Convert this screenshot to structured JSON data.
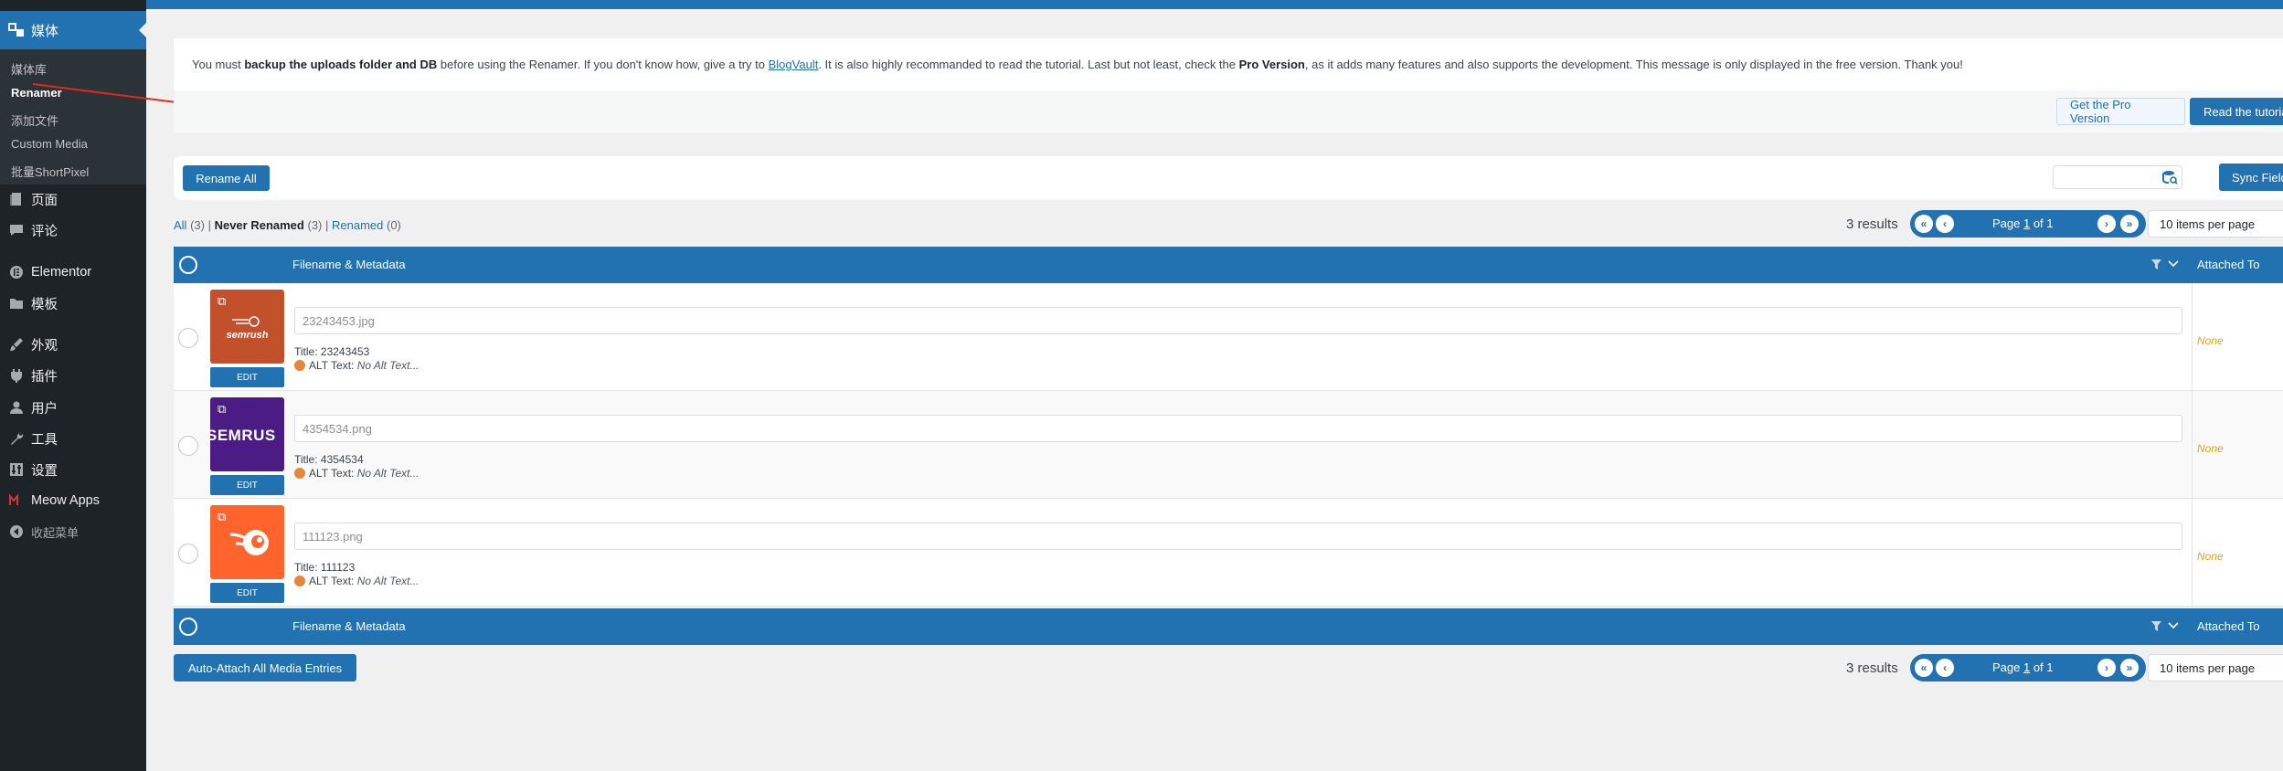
{
  "sidebar": {
    "current": "媒体",
    "submenu": [
      "媒体库",
      "Renamer",
      "添加文件",
      "Custom Media",
      "批量ShortPixel"
    ],
    "items": [
      {
        "icon": "pages-icon",
        "label": "页面"
      },
      {
        "icon": "comments-icon",
        "label": "评论"
      },
      {
        "icon": "elementor-icon",
        "label": "Elementor"
      },
      {
        "icon": "templates-icon",
        "label": "模板"
      },
      {
        "icon": "appearance-icon",
        "label": "外观"
      },
      {
        "icon": "plugins-icon",
        "label": "插件"
      },
      {
        "icon": "users-icon",
        "label": "用户"
      },
      {
        "icon": "tools-icon",
        "label": "工具"
      },
      {
        "icon": "settings-icon",
        "label": "设置"
      },
      {
        "icon": "meow-icon",
        "label": "Meow Apps"
      },
      {
        "icon": "collapse-icon",
        "label": "收起菜单"
      }
    ]
  },
  "notice": {
    "t1": "You must ",
    "b1": "backup the uploads folder and DB",
    "t2": " before using the Renamer. If you don't know how, give a try to ",
    "link": "BlogVault",
    "t3": ". It is also highly recommanded to read the tutorial. Last but not least, check the ",
    "b2": "Pro Version",
    "t4": ", as it adds many features and also supports the development. This message is only displayed in the free version. Thank you!",
    "pro_button": "Get the Pro Version",
    "tutorial_button": "Read the tutorial"
  },
  "toolbar": {
    "rename_all": "Rename All",
    "sync_fields": "Sync Fields"
  },
  "filters": {
    "all": "All",
    "all_count": "(3)",
    "never": "Never Renamed",
    "never_count": "(3)",
    "renamed": "Renamed",
    "renamed_count": "(0)"
  },
  "pagination": {
    "results": "3 results",
    "page_prefix": "Page ",
    "page_num": "1",
    "page_suffix": " of 1",
    "per_page": "10 items per page"
  },
  "table": {
    "col_filename": "Filename & Metadata",
    "col_attached": "Attached To",
    "title_label": "Title: ",
    "alt_label": "ALT Text: ",
    "alt_value": "No Alt Text...",
    "edit": "EDIT",
    "attached_none": "None",
    "rows": [
      {
        "filename": "23243453.jpg",
        "title": "23243453",
        "thumb_text": "semrush",
        "thumb_color": "#c2502b"
      },
      {
        "filename": "4354534.png",
        "title": "4354534",
        "thumb_text": "SEMRUS",
        "thumb_color": "#4b1d84"
      },
      {
        "filename": "111123.png",
        "title": "111123",
        "thumb_text": "",
        "thumb_color": "#ff642d"
      }
    ]
  },
  "footer": {
    "auto_attach": "Auto-Attach All Media Entries"
  }
}
